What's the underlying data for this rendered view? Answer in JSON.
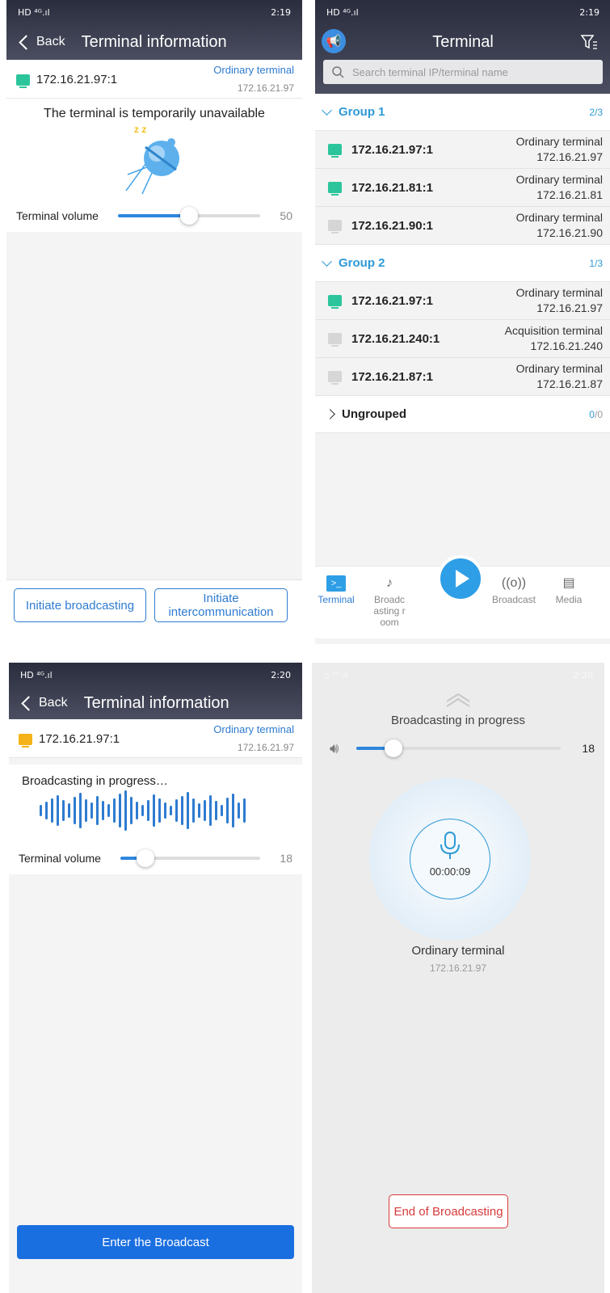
{
  "panel1": {
    "status": {
      "left": "HD ⁴ᴳ.ıl",
      "time": "2:19"
    },
    "nav": {
      "back": "Back",
      "title": "Terminal information"
    },
    "terminal": {
      "ip": "172.16.21.97:1",
      "kind": "Ordinary terminal",
      "address": "172.16.21.97"
    },
    "message": "The terminal is temporarily unavailable",
    "sleep_letters": "z z",
    "volume": {
      "label": "Terminal volume",
      "value": 50
    },
    "buttons": {
      "broadcast": "Initiate broadcasting",
      "intercom": "Initiate intercommunication"
    }
  },
  "panel2": {
    "status": {
      "left": "HD ⁴ᴳ.ıl",
      "time": "2:19"
    },
    "title": "Terminal",
    "search_placeholder": "Search terminal IP/terminal name",
    "groups": [
      {
        "name": "Group 1",
        "count": "2/3",
        "terminals": [
          {
            "ip": "172.16.21.97:1",
            "kind": "Ordinary terminal",
            "address": "172.16.21.97",
            "status": "online"
          },
          {
            "ip": "172.16.21.81:1",
            "kind": "Ordinary terminal",
            "address": "172.16.21.81",
            "status": "online"
          },
          {
            "ip": "172.16.21.90:1",
            "kind": "Ordinary terminal",
            "address": "172.16.21.90",
            "status": "offline"
          }
        ]
      },
      {
        "name": "Group 2",
        "count": "1/3",
        "terminals": [
          {
            "ip": "172.16.21.97:1",
            "kind": "Ordinary terminal",
            "address": "172.16.21.97",
            "status": "online"
          },
          {
            "ip": "172.16.21.240:1",
            "kind": "Acquisition terminal",
            "address": "172.16.21.240",
            "status": "offline"
          },
          {
            "ip": "172.16.21.87:1",
            "kind": "Ordinary terminal",
            "address": "172.16.21.87",
            "status": "offline"
          }
        ]
      }
    ],
    "ungrouped": {
      "name": "Ungrouped",
      "count_a": "0",
      "count_b": "/0"
    },
    "tabs": {
      "terminal": "Terminal",
      "room": "Broadc asting room",
      "broadcast": "Broadcast",
      "media": "Media"
    },
    "colors": {
      "accent": "#2e9ad6"
    }
  },
  "panel3": {
    "status": {
      "left": "HD ⁴ᴳ.ıl",
      "time": "2:20"
    },
    "nav": {
      "back": "Back",
      "title": "Terminal information"
    },
    "terminal": {
      "ip": "172.16.21.97:1",
      "kind": "Ordinary terminal",
      "address": "172.16.21.97"
    },
    "message": "Broadcasting in progress…",
    "volume": {
      "label": "Terminal volume",
      "value": 18
    },
    "enter_button": "Enter the Broadcast"
  },
  "panel4": {
    "status": {
      "time": "2:20"
    },
    "heading": "Broadcasting in progress",
    "volume": {
      "value": 18
    },
    "timer": "00:00:09",
    "terminal_kind": "Ordinary terminal",
    "terminal_address": "172.16.21.97",
    "end_button": "End of Broadcasting"
  }
}
